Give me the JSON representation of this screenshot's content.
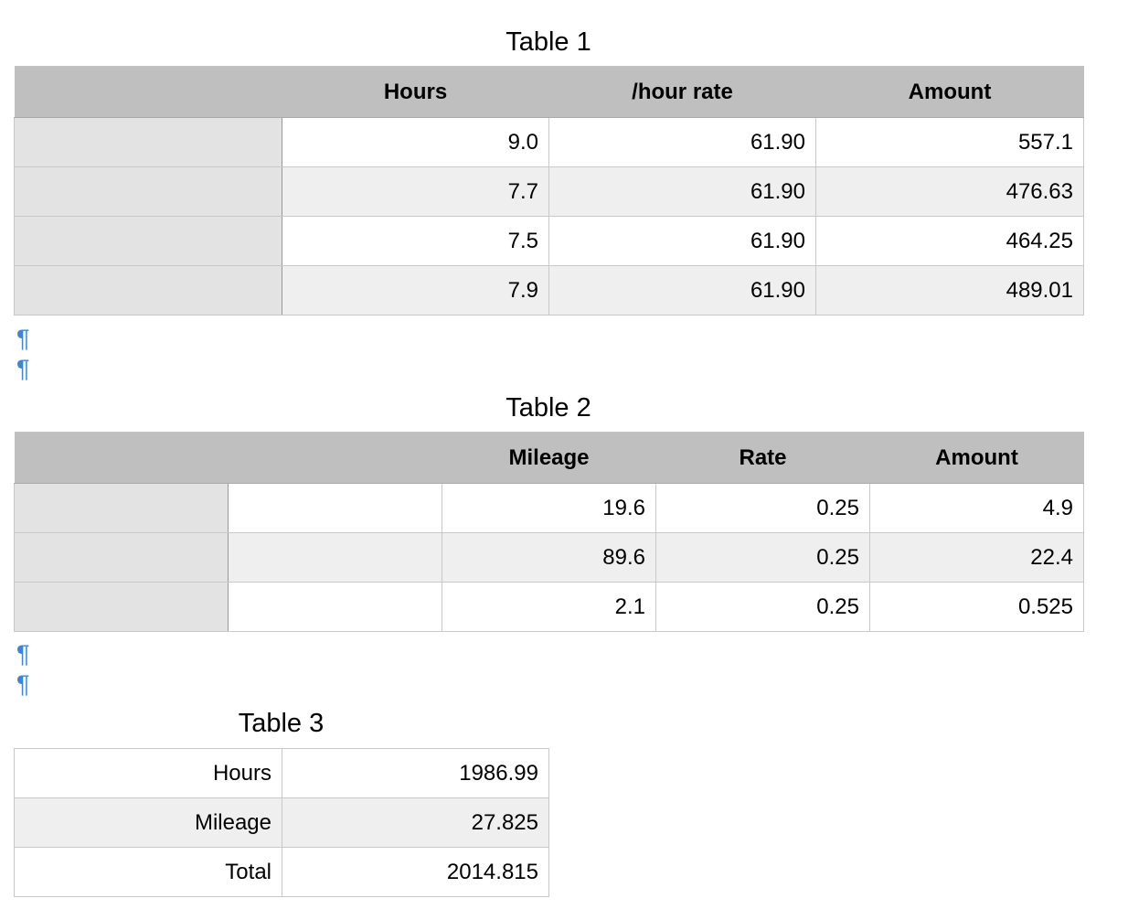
{
  "table1": {
    "title": "Table 1",
    "headers": [
      "",
      "Hours",
      "/hour rate",
      "Amount"
    ],
    "rows": [
      [
        "",
        "9.0",
        "61.90",
        "557.1"
      ],
      [
        "",
        "7.7",
        "61.90",
        "476.63"
      ],
      [
        "",
        "7.5",
        "61.90",
        "464.25"
      ],
      [
        "",
        "7.9",
        "61.90",
        "489.01"
      ]
    ]
  },
  "table2": {
    "title": "Table 2",
    "headers": [
      "",
      "",
      "Mileage",
      "Rate",
      "Amount"
    ],
    "rows": [
      [
        "",
        "",
        "19.6",
        "0.25",
        "4.9"
      ],
      [
        "",
        "",
        "89.6",
        "0.25",
        "22.4"
      ],
      [
        "",
        "",
        "2.1",
        "0.25",
        "0.525"
      ]
    ]
  },
  "table3": {
    "title": "Table 3",
    "rows": [
      [
        "Hours",
        "1986.99"
      ],
      [
        "Mileage",
        "27.825"
      ],
      [
        "Total",
        "2014.815"
      ]
    ]
  },
  "marks": {
    "pilcrow": "¶"
  }
}
